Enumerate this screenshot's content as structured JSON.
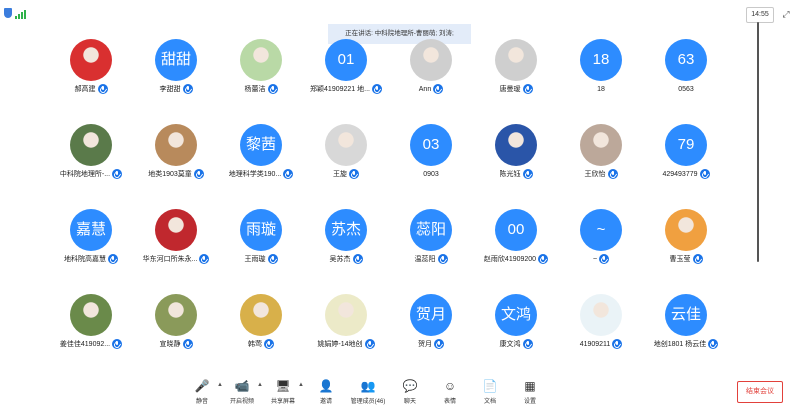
{
  "status": {
    "time": "14:55"
  },
  "speaking_banner": "正在讲话: 中科院地理所-曹丽萌; 刘涛;",
  "participants": [
    {
      "name": "郝高建",
      "avatar_type": "photo",
      "avatar_color": "#d93030",
      "muted": true
    },
    {
      "name": "李甜甜",
      "avatar_type": "text",
      "avatar_text": "甜甜",
      "muted": true
    },
    {
      "name": "杨蕾洁",
      "avatar_type": "photo",
      "avatar_color": "#b9d9a6",
      "muted": true
    },
    {
      "name": "郑颖41909221 地...",
      "avatar_type": "text",
      "avatar_text": "01",
      "muted": true
    },
    {
      "name": "Ann",
      "avatar_type": "photo",
      "avatar_color": "#cfcfcf",
      "muted": true
    },
    {
      "name": "唐曼瑷",
      "avatar_type": "photo",
      "avatar_color": "#cfcfcf",
      "muted": true
    },
    {
      "name": "18",
      "avatar_type": "text",
      "avatar_text": "18",
      "muted": false
    },
    {
      "name": "0563",
      "avatar_type": "text",
      "avatar_text": "63",
      "muted": false
    },
    {
      "name": "中科院地理所-...",
      "avatar_type": "photo",
      "avatar_color": "#5a7a4a",
      "muted": true
    },
    {
      "name": "地类1903莫童",
      "avatar_type": "photo",
      "avatar_color": "#b88a5c",
      "muted": true
    },
    {
      "name": "地理科学类190...",
      "avatar_type": "text",
      "avatar_text": "黎茜",
      "muted": true
    },
    {
      "name": "王旋",
      "avatar_type": "photo",
      "avatar_color": "#d8d8d8",
      "muted": true
    },
    {
      "name": "0903",
      "avatar_type": "text",
      "avatar_text": "03",
      "muted": false
    },
    {
      "name": "陈光钰",
      "avatar_type": "photo",
      "avatar_color": "#2a55a8",
      "muted": true
    },
    {
      "name": "王欣怡",
      "avatar_type": "photo",
      "avatar_color": "#bca89a",
      "muted": true
    },
    {
      "name": "429493779",
      "avatar_type": "text",
      "avatar_text": "79",
      "muted": true
    },
    {
      "name": "地科院高嘉慧",
      "avatar_type": "text",
      "avatar_text": "嘉慧",
      "muted": true
    },
    {
      "name": "华东河口所朱永...",
      "avatar_type": "photo",
      "avatar_color": "#c0282e",
      "muted": true
    },
    {
      "name": "王雨璇",
      "avatar_type": "text",
      "avatar_text": "雨璇",
      "muted": true
    },
    {
      "name": "吴苏杰",
      "avatar_type": "text",
      "avatar_text": "苏杰",
      "muted": true
    },
    {
      "name": "温蕊阳",
      "avatar_type": "text",
      "avatar_text": "蕊阳",
      "muted": true
    },
    {
      "name": "赵雨欣41909200",
      "avatar_type": "text",
      "avatar_text": "00",
      "muted": true
    },
    {
      "name": "~",
      "avatar_type": "text",
      "avatar_text": "~",
      "muted": true
    },
    {
      "name": "曹玉莹",
      "avatar_type": "photo",
      "avatar_color": "#f0a040",
      "muted": true
    },
    {
      "name": "姜佳佳419092...",
      "avatar_type": "photo",
      "avatar_color": "#6a8a4a",
      "muted": true
    },
    {
      "name": "宣晓静",
      "avatar_type": "photo",
      "avatar_color": "#8a9a5a",
      "muted": true
    },
    {
      "name": "韩莺",
      "avatar_type": "photo",
      "avatar_color": "#d8b04a",
      "muted": true
    },
    {
      "name": "姚娟婷-14地创",
      "avatar_type": "photo",
      "avatar_color": "#eceac8",
      "muted": true
    },
    {
      "name": "贺月",
      "avatar_type": "text",
      "avatar_text": "贺月",
      "muted": true
    },
    {
      "name": "康文鸿",
      "avatar_type": "text",
      "avatar_text": "文鸿",
      "muted": true
    },
    {
      "name": "41909211",
      "avatar_type": "photo",
      "avatar_color": "#eaf3f7",
      "muted": true
    },
    {
      "name": "地创1801 杨云佳",
      "avatar_type": "text",
      "avatar_text": "云佳",
      "muted": true
    }
  ],
  "toolbar": [
    {
      "label": "静音",
      "icon": "mic-icon",
      "glyph": "🎤",
      "caret": true
    },
    {
      "label": "开启视频",
      "icon": "video-off-icon",
      "glyph": "📹",
      "caret": true
    },
    {
      "label": "共享屏幕",
      "icon": "share-screen-icon",
      "glyph": "🖥",
      "caret": true
    },
    {
      "label": "邀请",
      "icon": "invite-icon",
      "glyph": "👤",
      "caret": false
    },
    {
      "label": "管理成员(46)",
      "icon": "participants-icon",
      "glyph": "👥",
      "caret": false
    },
    {
      "label": "聊天",
      "icon": "chat-icon",
      "glyph": "💬",
      "caret": false
    },
    {
      "label": "表情",
      "icon": "emoji-icon",
      "glyph": "☺",
      "caret": false
    },
    {
      "label": "文档",
      "icon": "document-icon",
      "glyph": "📄",
      "caret": false
    },
    {
      "label": "设置",
      "icon": "settings-icon",
      "glyph": "▦",
      "caret": false
    }
  ],
  "end_meeting_label": "结束会议",
  "colors": {
    "accent": "#2d8cff",
    "end": "#e2413b",
    "mic": "#1a73e8"
  }
}
